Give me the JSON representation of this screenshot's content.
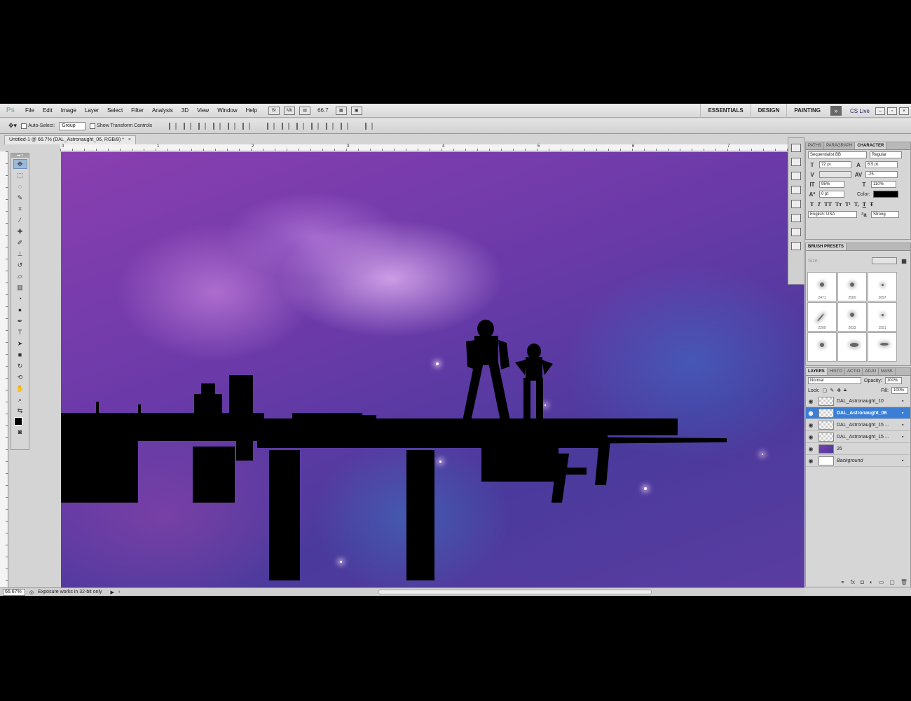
{
  "app": {
    "logo": "Ps"
  },
  "menu": [
    "File",
    "Edit",
    "Image",
    "Layer",
    "Select",
    "Filter",
    "Analysis",
    "3D",
    "View",
    "Window",
    "Help"
  ],
  "menubar_tools": {
    "zoom": "66.7"
  },
  "workspaces": [
    "ESSENTIALS",
    "DESIGN",
    "PAINTING"
  ],
  "cslive": "CS Live",
  "options": {
    "auto_select_label": "Auto-Select:",
    "auto_select_value": "Group",
    "show_transform_label": "Show Transform Controls"
  },
  "document": {
    "tab_title": "Untitled-1 @ 66.7% (DAL_Astronaught_06, RGB/8) *",
    "close": "×"
  },
  "rulers": {
    "top_numbers": [
      "0",
      "1",
      "2",
      "3",
      "4",
      "5",
      "6",
      "7"
    ]
  },
  "character_panel": {
    "tabs": [
      "PATHS",
      "PARAGRAPH",
      "CHARACTER"
    ],
    "font_family": "Sequentialist BB",
    "font_style": "Regular",
    "font_size": "72 pt",
    "leading": "6.5 pt",
    "kerning": "",
    "tracking": "-25",
    "vertical_scale": "95%",
    "horizontal_scale": "110%",
    "baseline_shift": "0 pt",
    "color_label": "Color:",
    "color_value": "#000000",
    "type_buttons": [
      "T",
      "T",
      "TT",
      "Tт",
      "T¹",
      "T,",
      "T",
      "Ŧ"
    ],
    "language": "English: USA",
    "antialias": "Strong",
    "aa_label": "ªa"
  },
  "brush_presets": {
    "title": "BRUSH PRESETS",
    "size_label": "Size:",
    "brushes": [
      "2471",
      "2500",
      "2097",
      "2209",
      "2033",
      "1551",
      "",
      "",
      ""
    ]
  },
  "layers_panel": {
    "tabs": [
      "LAYERS",
      "HISTO",
      "ACTIO",
      "ADJU",
      "MASK"
    ],
    "blend_mode": "Normal",
    "opacity_label": "Opacity:",
    "opacity_value": "100%",
    "lock_label": "Lock:",
    "fill_label": "Fill:",
    "fill_value": "100%",
    "layers": [
      {
        "name": "DAL_Astronaught_10",
        "selected": false
      },
      {
        "name": "DAL_Astronaught_06",
        "selected": true
      },
      {
        "name": "DAL_Astronaught_15 ...",
        "selected": false
      },
      {
        "name": "DAL_Astronaught_15 ...",
        "selected": false
      },
      {
        "name": "26",
        "selected": false
      },
      {
        "name": "Background",
        "selected": false
      }
    ]
  },
  "status": {
    "zoom": "66.67%",
    "message": "Exposure works in 32-bit only"
  }
}
